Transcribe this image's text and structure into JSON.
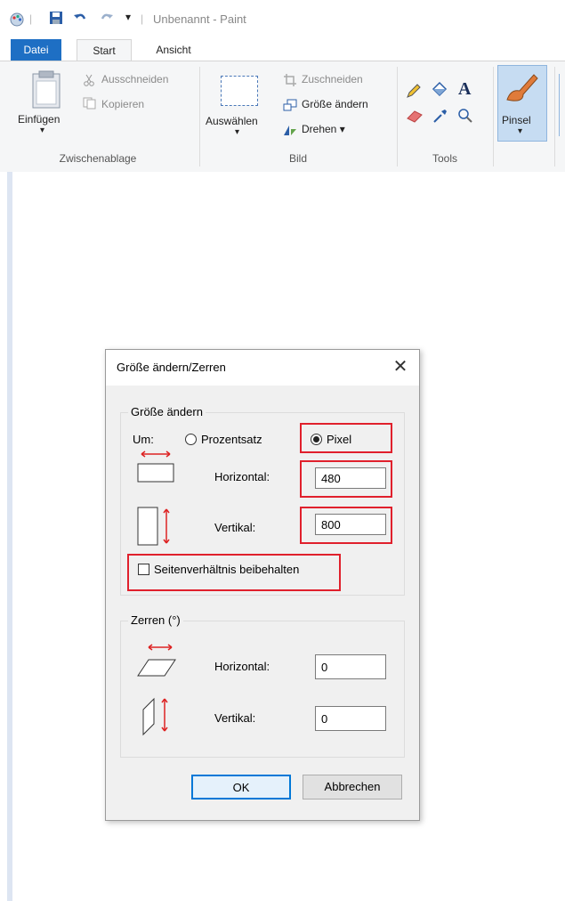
{
  "window": {
    "title": "Unbenannt - Paint"
  },
  "tabs": [
    {
      "label": "Datei"
    },
    {
      "label": "Start"
    },
    {
      "label": "Ansicht"
    }
  ],
  "ribbon": {
    "clipboard": {
      "paste_label": "Einfügen",
      "cut_label": "Ausschneiden",
      "copy_label": "Kopieren",
      "group_label": "Zwischenablage"
    },
    "image": {
      "select_label": "Auswählen",
      "crop_label": "Zuschneiden",
      "resize_label": "Größe ändern",
      "rotate_label": "Drehen ▾",
      "group_label": "Bild"
    },
    "tools": {
      "group_label": "Tools"
    },
    "brush": {
      "label": "Pinsel"
    }
  },
  "dialog": {
    "title": "Größe ändern/Zerren",
    "resize_group": "Größe ändern",
    "by_label": "Um:",
    "percent_label": "Prozentsatz",
    "pixel_label": "Pixel",
    "selected_unit": "Pixel",
    "horizontal_label": "Horizontal:",
    "horizontal_value": "480",
    "vertical_label": "Vertikal:",
    "vertical_value": "800",
    "keep_ratio_label": "Seitenverhältnis beibehalten",
    "keep_ratio_checked": false,
    "skew_group": "Zerren (°)",
    "skew_horizontal_label": "Horizontal:",
    "skew_horizontal_value": "0",
    "skew_vertical_label": "Vertikal:",
    "skew_vertical_value": "0",
    "ok_label": "OK",
    "cancel_label": "Abbrechen"
  },
  "colors": {
    "accent": "#1e6fc4",
    "highlight": "#e0202c",
    "focus": "#0078d7"
  }
}
